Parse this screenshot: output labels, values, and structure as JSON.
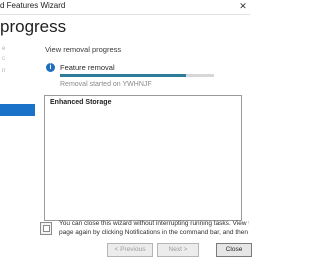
{
  "window": {
    "title": "d Features Wizard"
  },
  "header": {
    "heading": "progress"
  },
  "nav": {
    "items": [
      "e",
      "c",
      "n",
      "n",
      "n"
    ]
  },
  "content": {
    "section_label": "View removal progress",
    "feature_label": "Feature removal",
    "progress_fraction": 0.82,
    "started_text": "Removal started on YWHNJF",
    "results_title": "Enhanced Storage"
  },
  "notice": {
    "line1": "You can close this wizard without interrupting running tasks. View task progress",
    "line2": "page again by clicking Notifications in the command bar, and then Task Details."
  },
  "buttons": {
    "previous": "< Previous",
    "next": "Next >",
    "close": "Close"
  },
  "colors": {
    "accent": "#1a73c9",
    "progress": "#2d7d9a"
  }
}
